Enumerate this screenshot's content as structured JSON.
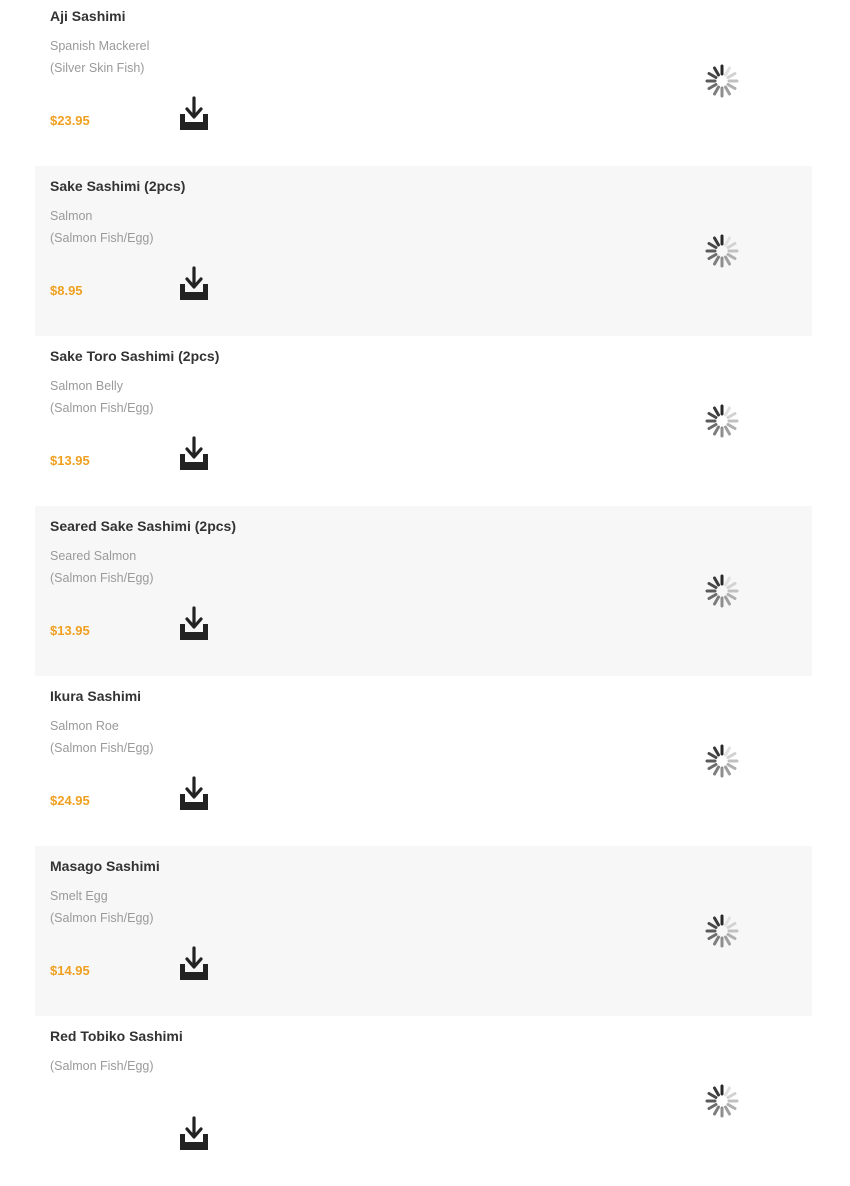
{
  "menu": {
    "items": [
      {
        "name": "Aji Sashimi",
        "desc_line1": "Spanish Mackerel",
        "desc_line2": "(Silver Skin Fish)",
        "price": "$23.95"
      },
      {
        "name": "Sake Sashimi (2pcs)",
        "desc_line1": "Salmon",
        "desc_line2": "(Salmon Fish/Egg)",
        "price": "$8.95"
      },
      {
        "name": "Sake Toro Sashimi (2pcs)",
        "desc_line1": "Salmon Belly",
        "desc_line2": "(Salmon Fish/Egg)",
        "price": "$13.95"
      },
      {
        "name": "Seared Sake Sashimi (2pcs)",
        "desc_line1": "Seared Salmon",
        "desc_line2": "(Salmon Fish/Egg)",
        "price": "$13.95"
      },
      {
        "name": "Ikura Sashimi",
        "desc_line1": "Salmon Roe",
        "desc_line2": "(Salmon Fish/Egg)",
        "price": "$24.95"
      },
      {
        "name": "Masago Sashimi",
        "desc_line1": "Smelt Egg",
        "desc_line2": "(Salmon Fish/Egg)",
        "price": "$14.95"
      },
      {
        "name": "Red Tobiko Sashimi",
        "desc_line1": "(Salmon Fish/Egg)",
        "desc_line2": "",
        "price": ""
      }
    ]
  },
  "icons": {
    "add_to_cart": "tray-download-icon",
    "image_placeholder": "loading-spinner-icon"
  },
  "colors": {
    "price": "#f0a020",
    "item_name": "#333333",
    "description": "#9a9a9a",
    "alt_row_background": "#f7f7f7"
  }
}
